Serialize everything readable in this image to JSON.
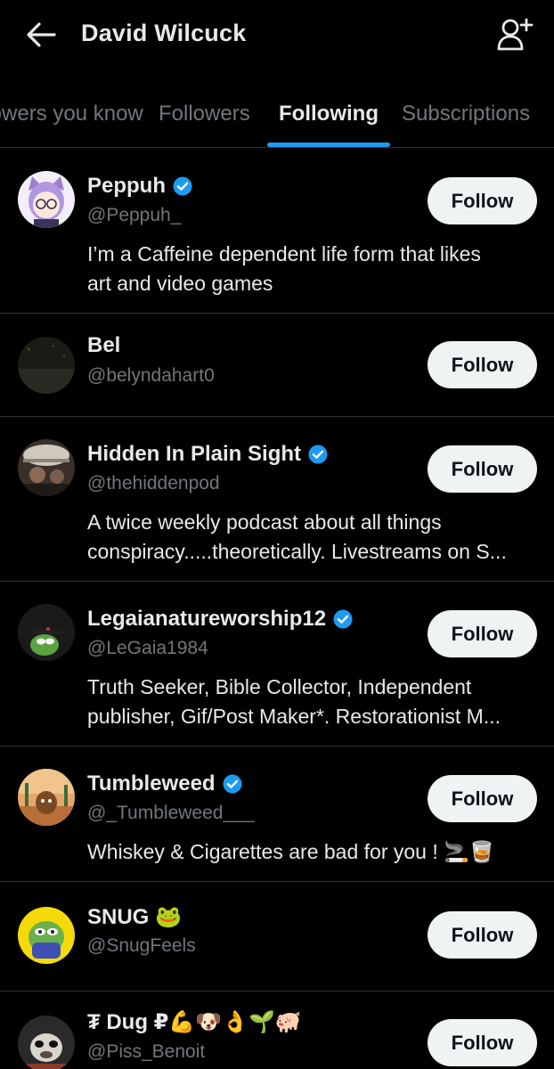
{
  "header": {
    "title": "David Wilcuck"
  },
  "tabs": [
    {
      "label": "Followers you know"
    },
    {
      "label": "Followers"
    },
    {
      "label": "Following"
    },
    {
      "label": "Subscriptions"
    }
  ],
  "accounts": [
    {
      "name": "Peppuh",
      "handle": "@Peppuh_",
      "bio": [
        "I’m a Caffeine dependent life form that likes",
        "art and video games"
      ],
      "follow_label": "Follow"
    },
    {
      "name": "Bel",
      "handle": "@belyndahart0",
      "bio": [],
      "follow_label": "Follow"
    },
    {
      "name": "Hidden In Plain Sight",
      "handle": "@thehiddenpod",
      "bio": [
        "A twice weekly podcast about all things",
        "conspiracy.....theoretically. Livestreams on S..."
      ],
      "follow_label": "Follow"
    },
    {
      "name": "Legaianatureworship12",
      "handle": "@LeGaia1984",
      "bio": [
        "Truth Seeker, Bible Collector, Independent",
        "publisher, Gif/Post Maker*. Restorationist M..."
      ],
      "follow_label": "Follow"
    },
    {
      "name": "Tumbleweed",
      "handle": "@_Tumbleweed___",
      "bio": [
        "Whiskey & Cigarettes are bad for you ! 🚬🥃"
      ],
      "follow_label": "Follow"
    },
    {
      "name": "SNUG 🐸",
      "handle": "@SnugFeels",
      "bio": [],
      "follow_label": "Follow"
    },
    {
      "name": "₮ Dug ₽💪🐶👌🌱🐖",
      "handle": "@Piss_Benoit",
      "bio": [],
      "follow_label": "Follow"
    }
  ],
  "colors": {
    "accent": "#1d9bf0",
    "background": "#000000",
    "secondary_text": "#71767b",
    "divider": "#2f3336"
  },
  "icons": {
    "back": "arrow-left-icon",
    "add_user": "person-add-icon",
    "verified": "verified-badge-icon"
  }
}
